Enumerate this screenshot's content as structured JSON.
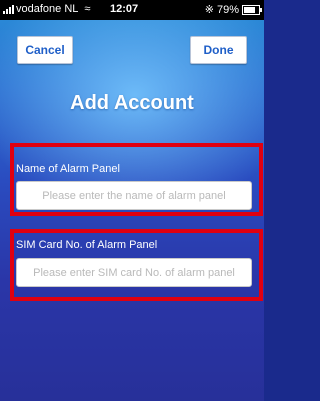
{
  "status_bar": {
    "carrier": "vodafone NL",
    "time": "12:07",
    "battery": "79%",
    "battery_level": 0.79
  },
  "nav": {
    "cancel_label": "Cancel",
    "done_label": "Done"
  },
  "title": "Add Account",
  "fields": [
    {
      "label": "Name of Alarm Panel",
      "placeholder": "Please enter the name of alarm panel"
    },
    {
      "label": "SIM Card No. of Alarm Panel",
      "placeholder": "Please enter SIM card No. of alarm panel"
    }
  ],
  "colors": {
    "highlight_border": "#e00010",
    "button_text": "#1f5fc8"
  },
  "icons": [
    "signal-icon",
    "wifi-icon",
    "bluetooth-icon",
    "battery-icon"
  ]
}
